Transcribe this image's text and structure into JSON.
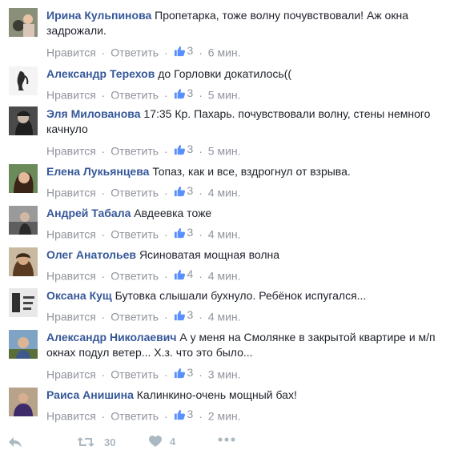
{
  "comments": [
    {
      "author": "Ирина Кульпинова",
      "text": "Пропетарка, тоже волну почувствовали! Аж окна задрожали.",
      "likes": "3",
      "time": "6 мин."
    },
    {
      "author": "Александр Терехов",
      "text": "до Горловки докатилось((",
      "likes": "3",
      "time": "5 мин."
    },
    {
      "author": "Эля Милованова",
      "text": "17:35 Кр. Пахарь. почувствовали волну, стены немного качнуло",
      "likes": "3",
      "time": "5 мин."
    },
    {
      "author": "Елена Лукьянцева",
      "text": "Топаз, как и все, вздрогнул от взрыва.",
      "likes": "3",
      "time": "4 мин."
    },
    {
      "author": "Андрей Табала",
      "text": "Авдеевка тоже",
      "likes": "3",
      "time": "4 мин."
    },
    {
      "author": "Олег Анатольев",
      "text": "Ясиноватая мощная волна",
      "likes": "4",
      "time": "4 мин."
    },
    {
      "author": "Оксана Кущ",
      "text": "Бутовка слышали бухнуло. Ребёнок испугался...",
      "likes": "3",
      "time": "4 мин."
    },
    {
      "author": "Александр Николаевич",
      "text": "А у меня на Смолянке в закрытой квартире и м/п окнах подул ветер... Х.з. что это было...",
      "likes": "3",
      "time": "3 мин."
    },
    {
      "author": "Раиса Анишина",
      "text": "Калинкино-очень мощный бах!",
      "likes": "3",
      "time": "2 мин."
    }
  ],
  "labels": {
    "like": "Нравится",
    "reply": "Ответить",
    "sep": "·"
  },
  "footer": {
    "retweets": "30",
    "favorites": "4"
  },
  "colors": {
    "author": "#365899",
    "meta": "#90949c",
    "like_icon": "#5890ff",
    "footer_icon": "#aab8c2"
  },
  "icons": {
    "like": "thumbs-up-icon",
    "reply": "reply-icon",
    "retweet": "retweet-icon",
    "favorite": "heart-icon",
    "more": "more-icon"
  }
}
